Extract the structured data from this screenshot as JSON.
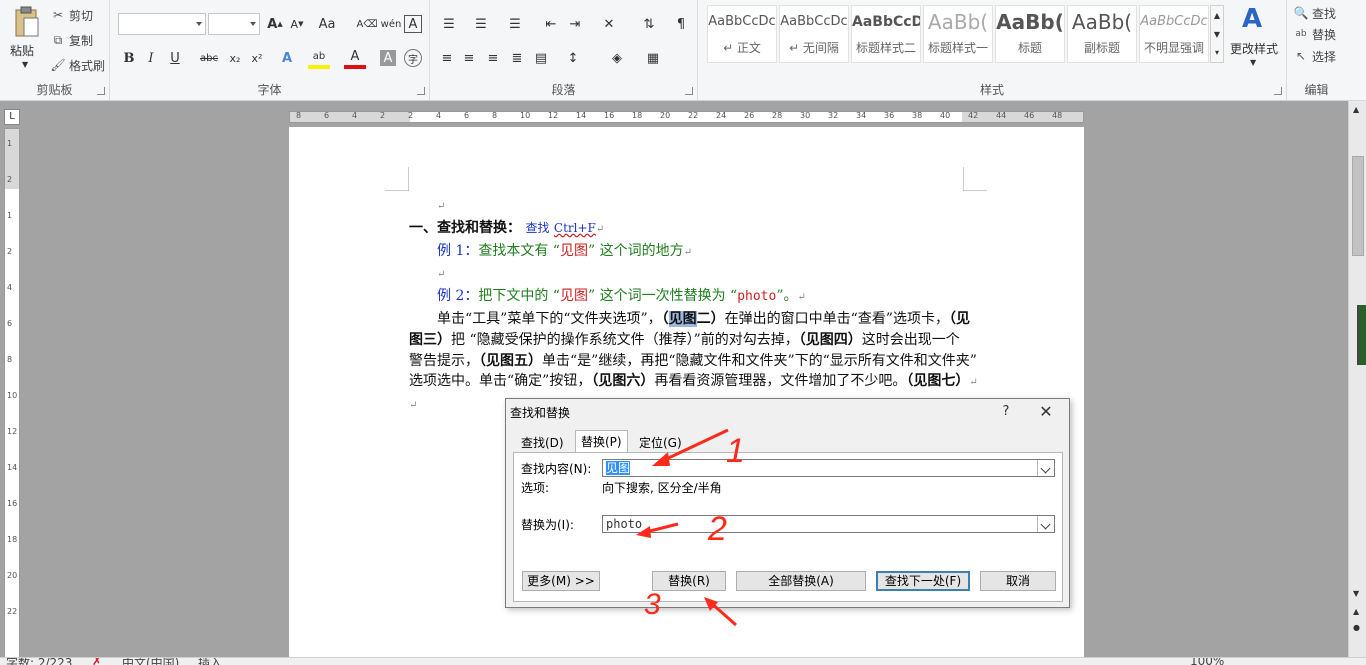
{
  "ribbon": {
    "clipboard": {
      "paste": "粘贴",
      "cut": "剪切",
      "copy": "复制",
      "format_painter": "格式刷",
      "label": "剪贴板"
    },
    "font": {
      "label": "字体"
    },
    "paragraph": {
      "label": "段落"
    },
    "styles": {
      "label": "样式",
      "items": [
        {
          "sample": "AaBbCcDc",
          "name": "↵ 正文"
        },
        {
          "sample": "AaBbCcDc",
          "name": "↵ 无间隔"
        },
        {
          "sample": "AaBbCcD",
          "name": "标题样式二"
        },
        {
          "sample": "AaBb(",
          "name": "标题样式一"
        },
        {
          "sample": "AaBb(",
          "name": "标题"
        },
        {
          "sample": "AaBb(",
          "name": "副标题"
        },
        {
          "sample": "AaBbCcDc",
          "name": "不明显强调"
        }
      ],
      "change_styles": "更改样式"
    },
    "editing": {
      "label": "编辑",
      "find": "查找",
      "replace": "替换",
      "select": "选择"
    }
  },
  "ruler": {
    "numbers": [
      "8",
      "6",
      "4",
      "2",
      "2",
      "4",
      "6",
      "8",
      "10",
      "12",
      "14",
      "16",
      "18",
      "20",
      "22",
      "24",
      "26",
      "28",
      "30",
      "32",
      "34",
      "36",
      "38",
      "40",
      "42",
      "44",
      "46",
      "48"
    ],
    "vnumbers": [
      "1",
      "2",
      "1",
      "2",
      "4",
      "6",
      "8",
      "10",
      "12",
      "14",
      "16",
      "18",
      "20",
      "22"
    ]
  },
  "document": {
    "heading_prefix": "一、",
    "heading": "查找和替换：",
    "heading_find": "查找",
    "heading_shortcut": "Ctrl+F",
    "ex1_label": "例 1：",
    "ex1_text_a": "查找本文有 “",
    "ex1_term": "见图",
    "ex1_text_b": "” 这个词的地方",
    "ex2_label": "例 2：",
    "ex2_text_a": "把下文中的 “",
    "ex2_term": "见图",
    "ex2_text_b": "” 这个词一次性替换为 “",
    "ex2_target": "photo",
    "ex2_text_c": "”。",
    "body_l1_a": "单击“工具”菜单下的“文件夹选项”，",
    "body_l1_b1": "（",
    "body_l1_sel": "见图",
    "body_l1_b2": "二）",
    "body_l1_c": "在弹出的窗口中单击“查看”选项卡，",
    "body_l1_d": "（见",
    "body_l2_a": "图三）",
    "body_l2_b": "把 “隐藏受保护的操作系统文件（推荐）”前的对勾去掉，",
    "body_l2_c": "（见图四）",
    "body_l2_d": "这时会出现一个",
    "body_l3_a": "警告提示，",
    "body_l3_b": "（见图五）",
    "body_l3_c": "单击“是”继续，再把“隐藏文件和文件夹”下的“显示所有文件和文件夹”",
    "body_l4_a": "选项选中。单击“确定”按钮，",
    "body_l4_b": "（见图六）",
    "body_l4_c": "再看看资源管理器，文件增加了不少吧。",
    "body_l4_d": "（见图七）",
    "para_mark": "↵"
  },
  "dialog": {
    "title": "查找和替换",
    "help": "?",
    "close": "✕",
    "tabs": [
      "查找(D)",
      "替换(P)",
      "定位(G)"
    ],
    "find_label": "查找内容(N):",
    "find_value": "见图",
    "options_label": "选项:",
    "options_value": "向下搜索, 区分全/半角",
    "replace_label": "替换为(I):",
    "replace_value": "photo",
    "more_button": "更多(M) >>",
    "replace_button": "替换(R)",
    "replace_all_button": "全部替换(A)",
    "find_next_button": "查找下一处(F)",
    "cancel_button": "取消"
  },
  "annotations": {
    "step1": "1",
    "step2": "2",
    "step3": "3",
    "color": "#ff2a1a"
  },
  "statusbar": {
    "word_count": "字数: 2/223",
    "language": "中文(中国)",
    "mode": "插入",
    "zoom": "100%"
  }
}
